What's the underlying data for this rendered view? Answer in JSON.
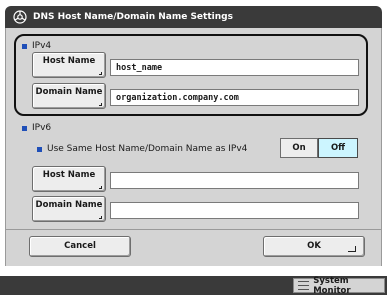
{
  "dialog": {
    "title": "DNS Host Name/Domain Name Settings",
    "title_icon": "settings-gear-icon"
  },
  "ipv4": {
    "section_label": "IPv4",
    "host_name_button": "Host Name",
    "host_name_value": "host_name",
    "domain_name_button": "Domain Name",
    "domain_name_value": "organization.company.com"
  },
  "ipv6": {
    "section_label": "IPv6",
    "use_same_label": "Use Same Host Name/Domain Name as IPv4",
    "toggle_on_label": "On",
    "toggle_off_label": "Off",
    "selected_toggle": "Off",
    "host_name_button": "Host Name",
    "host_name_value": "",
    "domain_name_button": "Domain Name",
    "domain_name_value": ""
  },
  "footer": {
    "cancel_label": "Cancel",
    "ok_label": "OK"
  },
  "status": {
    "system_monitor_label": "System Monitor"
  },
  "colors": {
    "title_bar": "#3a3a3a",
    "panel": "#d4d4d4",
    "bullet": "#1f4fb8",
    "toggle_selected": "#ccf5ff"
  }
}
